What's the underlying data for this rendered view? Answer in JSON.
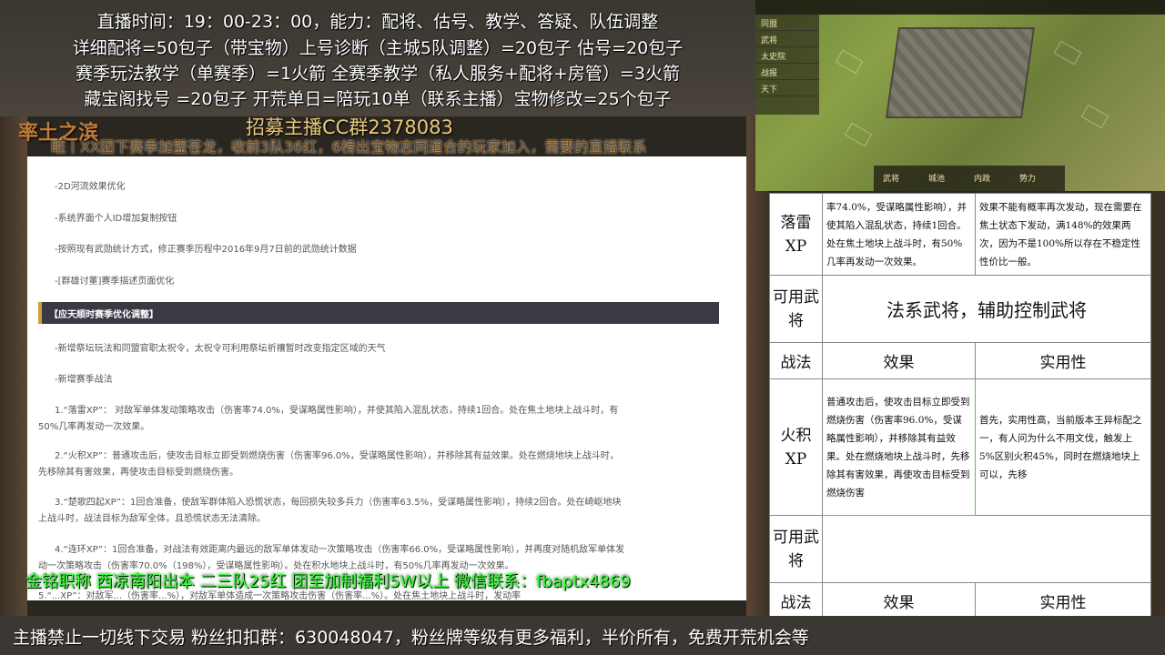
{
  "top_banner": {
    "line1": "直播时间：19：00-23：00，能力：配将、估号、教学、答疑、队伍调整",
    "line2": "详细配将=50包子（带宝物）上号诊断（主城5队调整）=20包子 估号=20包子",
    "line3": "赛季玩法教学（单赛季）=1火箭 全赛季教学（私人服务+配将+房管）=3火箭",
    "line4": "藏宝阁找号 =20包子 开荒单日=陪玩10单（联系主播）宝物修改=25个包子"
  },
  "brand_left": "率土之滨",
  "recruit": "招募主播CC群2378083",
  "marquee": "眠丨XX团下赛季加盟苍龙，收前3队36红，6榜出宝物志同道合的玩家加入，需要的直播联系",
  "document": {
    "items_top": [
      "-2D河流效果优化",
      "-系统界面个人ID增加复制按钮",
      "-按照现有武勋统计方式，修正赛季历程中2016年9月7日前的武勋统计数据",
      "-[群雄讨董]赛季描述页面优化"
    ],
    "section_title": "【应天顺时赛季优化调整】",
    "items_mid": [
      "-新增祭坛玩法和同盟官职太祝令，太祝令可利用祭坛祈禳暂时改变指定区域的天气",
      "-新增赛季战法"
    ],
    "skills": [
      "1.“落雷XP”：  对敌军单体发动策略攻击（伤害率74.0%，受谋略属性影响），并使其陷入混乱状态，持续1回合。处在焦土地块上战斗时，有",
      "50%几率再发动一次效果。",
      "2.“火积XP”：普通攻击后，使攻击目标立即受到燃烧伤害（伤害率96.0%，受谋略属性影响），并移除其有益效果。处在燃烧地块上战斗时，",
      "先移除其有害效果，再使攻击目标受到燃烧伤害。",
      "3.“楚歌四起XP”：1回合准备，使敌军群体陷入恐慌状态，每回损失较多兵力（伤害率63.5%，受谋略属性影响），持续2回合。处在崎岖地块",
      "上战斗时，战法目标为敌军全体，且恐慌状态无法清除。",
      "4.“连环XP”：1回合准备，对战法有效距离内最远的敌军单体发动一次策略攻击（伤害率66.0%，受谋略属性影响），并再度对随机敌军单体发",
      "动一次策略攻击（伤害率70.0%（198%），受谋略属性影响）。处在积水地块上战斗时，有50%几率再发动一次效果。",
      "5.“...XP”：对敌军...（伤害率...%），对敌军单体造成一次策略攻击伤害（伤害率...%）。处在焦土地块上战斗时，发动率"
    ]
  },
  "game": {
    "menu": [
      "同盟",
      "武将",
      "太史院",
      "战报",
      "天下"
    ],
    "dock": [
      "武将",
      "城池",
      "内政",
      "势力"
    ]
  },
  "ref_table": {
    "row1": {
      "name": "落雷XP",
      "effect": "率74.0%，受谋略属性影响），并使其陷入混乱状态，持续1回合。处在焦土地块上战斗时，有50%几率再发动一次效果。",
      "usefulness": "效果不能有概率再次发动，现在需要在焦土状态下发动，满148%的效果两次，因为不是100%所以存在不稳定性性价比一般。"
    },
    "available_label": "可用武将",
    "available_value": "法系武将，辅助控制武将",
    "hdr_skill": "战法",
    "hdr_effect": "效果",
    "hdr_use": "实用性",
    "row2": {
      "name": "火积XP",
      "effect": "普通攻击后，使攻击目标立即受到燃烧伤害（伤害率96.0%，受谋略属性影响），并移除其有益效果。处在燃烧地块上战斗时，先移除其有害效果，再使攻击目标受到燃烧伤害",
      "usefulness": "首先，实用性高，当前版本王异标配之一，有人问为什么不用文伐，触发上5%区别火积45%，同时在燃烧地块上可以，先移"
    },
    "available_label2": "可用武将",
    "hdr_skill2": "战法",
    "hdr_effect2": "效果",
    "hdr_use2": "实用性"
  },
  "ticker": "金铭职称  西凉南阳出本  二三队25红  团至加制福利5W以上  微信联系：fbaptx4869",
  "bottom": "主播禁止一切线下交易 粉丝扣扣群：630048047，粉丝牌等级有更多福利，半价所有，免费开荒机会等",
  "colors": {
    "ticker_green": "#3cff3c",
    "banner_bg": "#3b3732",
    "section_accent": "#c9a13a"
  }
}
